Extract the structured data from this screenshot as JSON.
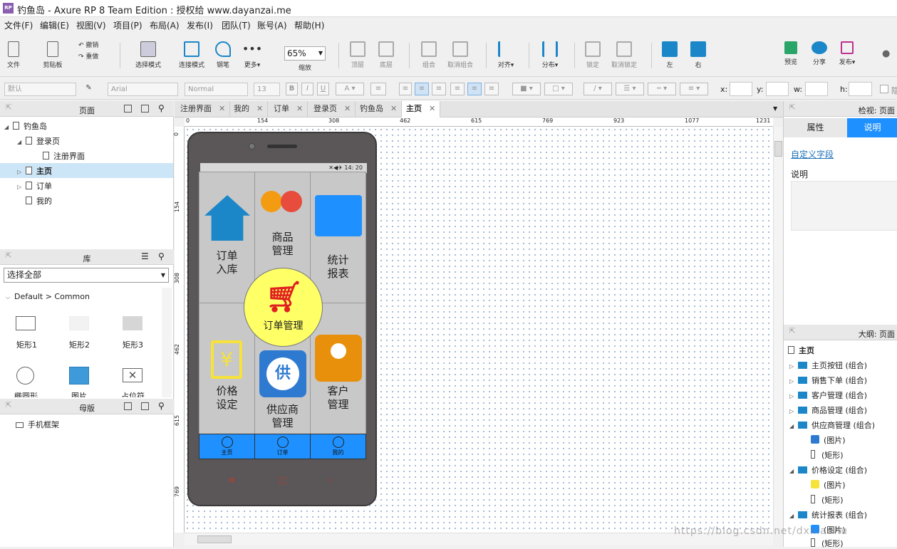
{
  "window": {
    "title": "钓鱼岛 - Axure RP 8 Team Edition : 授权给 www.dayanzai.me",
    "icon_text": "RP"
  },
  "menu": [
    "文件(F)",
    "编辑(E)",
    "视图(V)",
    "项目(P)",
    "布局(A)",
    "发布(I)",
    "团队(T)",
    "账号(A)",
    "帮助(H)"
  ],
  "toolbar": {
    "file": "文件",
    "clipboard": "剪贴板",
    "undo": "撤销",
    "redo": "重做",
    "select_mode": "选择模式",
    "connect_mode": "连接模式",
    "pen": "钢笔",
    "more": "更多▾",
    "zoom_value": "65%",
    "zoom": "缩放",
    "top": "顶层",
    "bottom": "底层",
    "group": "组合",
    "ungroup": "取消组合",
    "align": "对齐▾",
    "distribute": "分布▾",
    "lock": "锁定",
    "unlock": "取消锁定",
    "left": "左",
    "right": "右",
    "preview": "预览",
    "share": "分享",
    "publish": "发布▾"
  },
  "format": {
    "style": "默认",
    "font": "Arial",
    "weight": "Normal",
    "size": "13",
    "bold": "B",
    "italic": "I",
    "underline": "U",
    "x": "x:",
    "y": "y:",
    "w": "w:",
    "h": "h:",
    "hide": "隐"
  },
  "pages_panel": {
    "title": "页面",
    "items": [
      "钓鱼岛",
      "登录页",
      "注册界面",
      "主页",
      "订单",
      "我的"
    ]
  },
  "library_panel": {
    "title": "库",
    "select_value": "选择全部",
    "category": "Default > Common",
    "widgets": [
      "矩形1",
      "矩形2",
      "矩形3",
      "椭圆形",
      "图片",
      "占位符"
    ]
  },
  "masters_panel": {
    "title": "母版",
    "items": [
      "手机框架"
    ]
  },
  "tabs": [
    "注册界面",
    "我的",
    "订单",
    "登录页",
    "钓鱼岛",
    "主页"
  ],
  "ruler": {
    "h": [
      "0",
      "154",
      "308",
      "462",
      "615",
      "769",
      "923",
      "1077",
      "1231"
    ],
    "v": [
      "0",
      "154",
      "308",
      "462",
      "615",
      "769"
    ]
  },
  "phone": {
    "status_time": "14: 20",
    "cells": [
      "订单\n入库",
      "商品\n管理",
      "统计\n报表",
      "价格\n设定",
      "供应商\n管理",
      "客户\n管理"
    ],
    "center": "订单管理",
    "supplier_icon_text": "供",
    "nav": [
      "主页",
      "订单",
      "我的"
    ]
  },
  "inspector": {
    "title": "检视: 页面",
    "tab_props": "属性",
    "tab_notes": "说明",
    "custom_fields": "自定义字段",
    "notes_label": "说明"
  },
  "outline": {
    "title": "大纲: 页面",
    "root": "主页",
    "items": [
      "主页按钮 (组合)",
      "销售下单 (组合)",
      "客户管理 (组合)",
      "商品管理 (组合)",
      "供应商管理 (组合)",
      "(图片)",
      "(矩形)",
      "价格设定 (组合)",
      "(图片)",
      "(矩形)",
      "统计报表 (组合)",
      "(图片)",
      "(矩形)"
    ]
  },
  "watermark": "https://blog.csdn.net/dxxiaohu",
  "colors": {
    "accent": "#1e90ff",
    "center_circle": "#ffff66",
    "cart": "#e02020"
  }
}
